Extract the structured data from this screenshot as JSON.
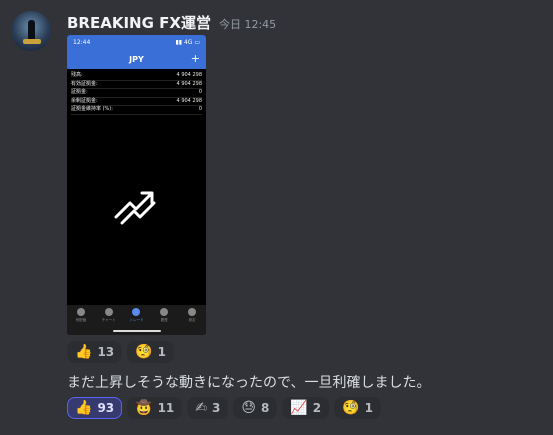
{
  "message": {
    "username": "BREAKING FX運営",
    "timestamp": "今日 12:45"
  },
  "screenshot": {
    "status_time": "12:44",
    "status_right": "▮▮ 4G ▭",
    "title": "JPY",
    "plus": "+",
    "rows": [
      {
        "label": "残高:",
        "value": "4 904 298"
      },
      {
        "label": "有効証拠金:",
        "value": "4 904 298"
      },
      {
        "label": "証拠金:",
        "value": "0"
      },
      {
        "label": "余剰証拠金:",
        "value": "4 904 298"
      },
      {
        "label": "証拠金維持率 (%):",
        "value": "0"
      }
    ],
    "tabs": [
      {
        "label": "気配値"
      },
      {
        "label": "チャート"
      },
      {
        "label": "トレード",
        "active": true
      },
      {
        "label": "履歴"
      },
      {
        "label": "設定"
      }
    ]
  },
  "reactions_first": [
    {
      "emoji": "👍",
      "count": "13"
    },
    {
      "emoji": "🧐",
      "count": "1"
    }
  ],
  "second_message": {
    "text": "まだ上昇しそうな動きになったので、一旦利確しました。"
  },
  "reactions_second": [
    {
      "emoji": "👍",
      "count": "93",
      "me": true
    },
    {
      "emoji": "🤠",
      "count": "11"
    },
    {
      "emoji": "✍",
      "count": "3"
    },
    {
      "emoji": "😓",
      "count": "8"
    },
    {
      "emoji": "📈",
      "count": "2"
    },
    {
      "emoji": "🧐",
      "count": "1"
    }
  ]
}
